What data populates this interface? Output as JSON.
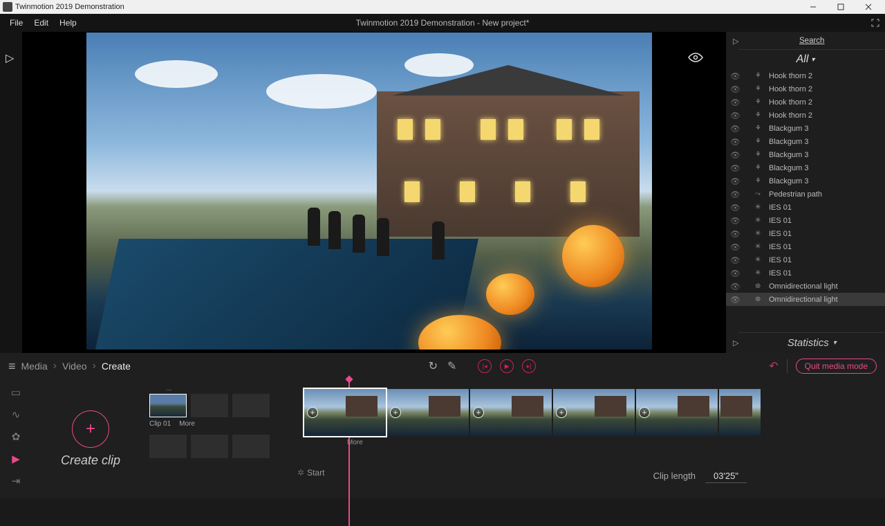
{
  "titlebar": {
    "appTitle": "Twinmotion 2019 Demonstration"
  },
  "menubar": {
    "items": [
      "File",
      "Edit",
      "Help"
    ],
    "centerTitle": "Twinmotion 2019 Demonstration - New project*"
  },
  "rightPanel": {
    "searchLabel": "Search",
    "filterLabel": "All",
    "statsLabel": "Statistics",
    "items": [
      {
        "label": "Hook thorn 2",
        "icon": "plant"
      },
      {
        "label": "Hook thorn 2",
        "icon": "plant"
      },
      {
        "label": "Hook thorn 2",
        "icon": "plant"
      },
      {
        "label": "Hook thorn 2",
        "icon": "plant"
      },
      {
        "label": "Blackgum 3",
        "icon": "plant"
      },
      {
        "label": "Blackgum 3",
        "icon": "plant"
      },
      {
        "label": "Blackgum 3",
        "icon": "plant"
      },
      {
        "label": "Blackgum 3",
        "icon": "plant"
      },
      {
        "label": "Blackgum 3",
        "icon": "plant"
      },
      {
        "label": "Pedestrian path",
        "icon": "path"
      },
      {
        "label": "IES 01",
        "icon": "light"
      },
      {
        "label": "IES 01",
        "icon": "light"
      },
      {
        "label": "IES 01",
        "icon": "light"
      },
      {
        "label": "IES 01",
        "icon": "light"
      },
      {
        "label": "IES 01",
        "icon": "light"
      },
      {
        "label": "IES 01",
        "icon": "light"
      },
      {
        "label": "Omnidirectional light",
        "icon": "omni"
      },
      {
        "label": "Omnidirectional light",
        "icon": "omni",
        "selected": true
      }
    ]
  },
  "breadcrumb": {
    "items": [
      "Media",
      "Video",
      "Create"
    ]
  },
  "bottom": {
    "createLabel": "Create clip",
    "quitLabel": "Quit media mode",
    "clip01": "Clip 01",
    "more": "More",
    "more2": "More",
    "start": "Start",
    "clipLengthLabel": "Clip length",
    "clipLengthValue": "03'25\""
  }
}
